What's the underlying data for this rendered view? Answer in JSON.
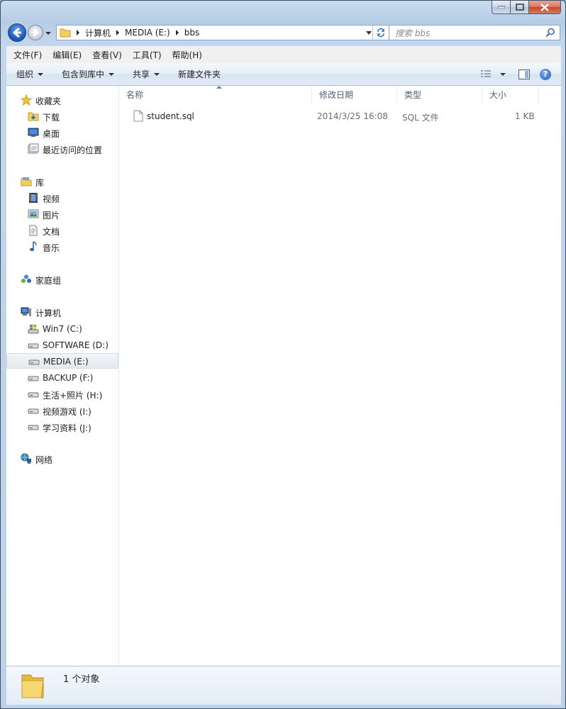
{
  "window": {
    "caption_buttons": [
      "minimize",
      "maximize",
      "close"
    ]
  },
  "nav": {
    "breadcrumb": [
      "计算机",
      "MEDIA (E:)",
      "bbs"
    ],
    "search_placeholder": "搜索 bbs"
  },
  "menu": [
    "文件(F)",
    "编辑(E)",
    "查看(V)",
    "工具(T)",
    "帮助(H)"
  ],
  "toolbar": {
    "organize": "组织",
    "include_library": "包含到库中",
    "share": "共享",
    "new_folder": "新建文件夹"
  },
  "sidebar": {
    "favorites": {
      "label": "收藏夹",
      "items": [
        "下载",
        "桌面",
        "最近访问的位置"
      ]
    },
    "libraries": {
      "label": "库",
      "items": [
        "视频",
        "图片",
        "文档",
        "音乐"
      ]
    },
    "homegroup": {
      "label": "家庭组"
    },
    "computer": {
      "label": "计算机",
      "items": [
        "Win7 (C:)",
        "SOFTWARE (D:)",
        "MEDIA (E:)",
        "BACKUP (F:)",
        "生活+照片 (H:)",
        "视频游戏 (I:)",
        "学习资料 (J:)"
      ],
      "selected": "MEDIA (E:)"
    },
    "network": {
      "label": "网络"
    }
  },
  "list": {
    "columns": [
      "名称",
      "修改日期",
      "类型",
      "大小"
    ],
    "sorted_column": "名称",
    "rows": [
      {
        "name": "student.sql",
        "modified": "2014/3/25 16:08",
        "type": "SQL 文件",
        "size": "1 KB"
      }
    ]
  },
  "status": {
    "count_text": "1 个对象"
  },
  "colors": {
    "accent": "#1f5fc0",
    "selection": "#e5e9ee",
    "header_text": "#4c607a"
  }
}
